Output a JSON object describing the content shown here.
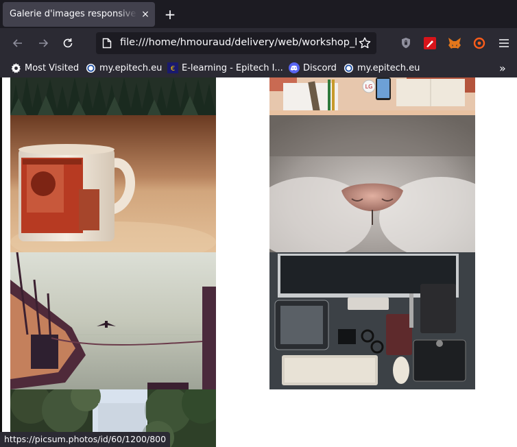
{
  "tab": {
    "title": "Galerie d'images responsive a",
    "close_glyph": "×"
  },
  "toolbar": {
    "new_tab_glyph": "+"
  },
  "urlbar": {
    "url": "file:///home/hmouraud/delivery/web/workshop_boo"
  },
  "bookmarks": [
    {
      "label": "Most Visited",
      "icon": "gear-icon"
    },
    {
      "label": "my.epitech.eu",
      "icon": "epitech-icon"
    },
    {
      "label": "E-learning - Epitech I...",
      "icon": "elearning-icon"
    },
    {
      "label": "Discord",
      "icon": "discord-icon"
    },
    {
      "label": "my.epitech.eu",
      "icon": "epitech-icon"
    }
  ],
  "bookmarks_overflow": "»",
  "gallery": {
    "images": [
      {
        "name": "forest-photo"
      },
      {
        "name": "desk-items-photo"
      },
      {
        "name": "mug-photo"
      },
      {
        "name": "cat-nose-photo"
      },
      {
        "name": "boat-bird-photo"
      },
      {
        "name": "workspace-devices-photo"
      },
      {
        "name": "trees-sky-photo"
      }
    ]
  },
  "status_url": "https://picsum.photos/id/60/1200/800",
  "colors": {
    "tabstrip": "#1c1b22",
    "toolbar": "#2b2a33",
    "tab_active": "#42414d",
    "text": "#fbfbfe"
  }
}
